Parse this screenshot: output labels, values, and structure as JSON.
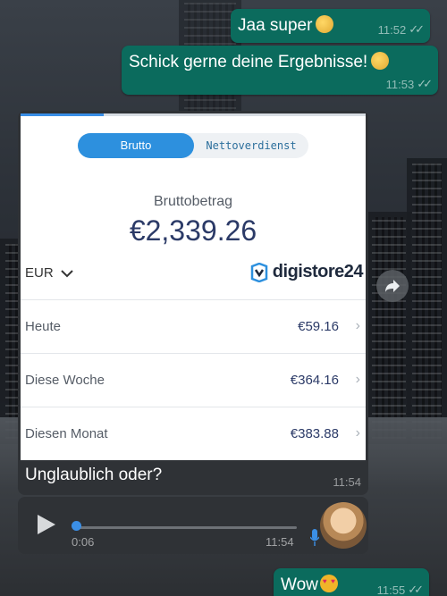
{
  "messages_out": [
    {
      "text": "Jaa super",
      "time": "11:52",
      "emoji": "thumbs-up"
    },
    {
      "text": "Schick gerne deine Ergebnisse!",
      "time": "11:53",
      "emoji": "ok-hand"
    },
    {
      "text": "Wow",
      "time": "11:55",
      "emoji": "heart-eyes"
    }
  ],
  "image_message": {
    "caption": "Unglaublich oder?",
    "time": "11:54",
    "screenshot": {
      "toggle": {
        "active": "Brutto",
        "inactive": "Nettoverdienst"
      },
      "amount_label": "Bruttobetrag",
      "amount": "€2,339.26",
      "currency": "EUR",
      "logo_text": "digistore24",
      "rows": [
        {
          "label": "Heute",
          "value": "€59.16"
        },
        {
          "label": "Diese Woche",
          "value": "€364.16"
        },
        {
          "label": "Diesen Monat",
          "value": "€383.88"
        }
      ],
      "load_progress": 0.24
    }
  },
  "voice_message": {
    "duration": "0:06",
    "time": "11:54",
    "progress": 0.0
  },
  "colors": {
    "outgoing": "#0b6b5d",
    "incoming": "#2f3236",
    "accent": "#2d90de",
    "amount": "#2b3a67"
  },
  "icons": {
    "share": "share-arrow-icon",
    "play": "play-icon",
    "mic": "microphone-icon",
    "ticks": "double-check-icon"
  }
}
